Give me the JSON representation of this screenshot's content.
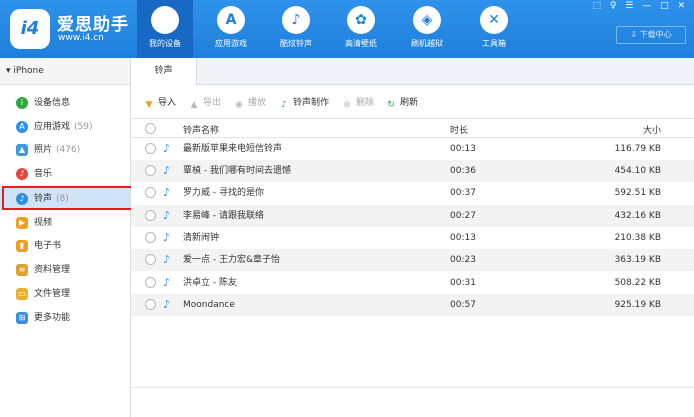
{
  "app": {
    "logo_text": "i4",
    "name": "爱思助手",
    "url": "www.i4.cn",
    "download_center": "下载中心",
    "window_controls": "⬚ ♀ ☰ — □ ✕"
  },
  "nav": [
    {
      "label": "我的设备",
      "icon": "apple-icon",
      "glyph": ""
    },
    {
      "label": "应用游戏",
      "icon": "appstore-icon",
      "glyph": "A"
    },
    {
      "label": "酷炫铃声",
      "icon": "bell-icon",
      "glyph": "♪"
    },
    {
      "label": "高清壁纸",
      "icon": "flower-icon",
      "glyph": "✿"
    },
    {
      "label": "刷机越狱",
      "icon": "box-icon",
      "glyph": "◈"
    },
    {
      "label": "工具箱",
      "icon": "tools-icon",
      "glyph": "✕"
    }
  ],
  "sidebar": {
    "device": "iPhone",
    "items": [
      {
        "label": "设备信息",
        "count": "",
        "icon": "info-icon",
        "color": "#2eaa3c",
        "glyph": "i"
      },
      {
        "label": "应用游戏",
        "count": "(59)",
        "icon": "appstore-icon",
        "color": "#2f8fe8",
        "glyph": "A"
      },
      {
        "label": "照片",
        "count": "(476)",
        "icon": "photo-icon",
        "color": "#3b9be0",
        "glyph": "▲"
      },
      {
        "label": "音乐",
        "count": "",
        "icon": "music-icon",
        "color": "#e8483a",
        "glyph": "♪"
      },
      {
        "label": "铃声",
        "count": "(8)",
        "icon": "bell-icon",
        "color": "#2f8fe8",
        "glyph": "♪"
      },
      {
        "label": "视频",
        "count": "",
        "icon": "video-icon",
        "color": "#f0a020",
        "glyph": "▶"
      },
      {
        "label": "电子书",
        "count": "",
        "icon": "book-icon",
        "color": "#f0a020",
        "glyph": "▮"
      },
      {
        "label": "资料管理",
        "count": "",
        "icon": "contacts-icon",
        "color": "#e0a030",
        "glyph": "≡"
      },
      {
        "label": "文件管理",
        "count": "",
        "icon": "folder-icon",
        "color": "#e8b030",
        "glyph": "▭"
      },
      {
        "label": "更多功能",
        "count": "",
        "icon": "more-icon",
        "color": "#3b8fe0",
        "glyph": "⊞"
      }
    ]
  },
  "tab": "铃声",
  "toolbar": {
    "import": "导入",
    "export": "导出",
    "play": "播放",
    "make": "铃声制作",
    "delete": "删除",
    "refresh": "刷新"
  },
  "table": {
    "headers": {
      "name": "铃声名称",
      "duration": "时长",
      "size": "大小"
    },
    "rows": [
      {
        "name": "最新版苹果来电短信铃声",
        "duration": "00:13",
        "size": "116.79 KB"
      },
      {
        "name": "覃楨 - 我们哪有时间去遗憾",
        "duration": "00:36",
        "size": "454.10 KB"
      },
      {
        "name": "罗力威 - 寻找的是你",
        "duration": "00:37",
        "size": "592.51 KB"
      },
      {
        "name": "李易峰 - 请跟我联络",
        "duration": "00:27",
        "size": "432.16 KB"
      },
      {
        "name": "清新闹钟",
        "duration": "00:13",
        "size": "210.38 KB"
      },
      {
        "name": "爱一点 - 王力宏&章子怡",
        "duration": "00:23",
        "size": "363.19 KB"
      },
      {
        "name": "洪卓立 - 陈友",
        "duration": "00:31",
        "size": "508.22 KB"
      },
      {
        "name": "Moondance",
        "duration": "00:57",
        "size": "925.19 KB"
      }
    ]
  }
}
